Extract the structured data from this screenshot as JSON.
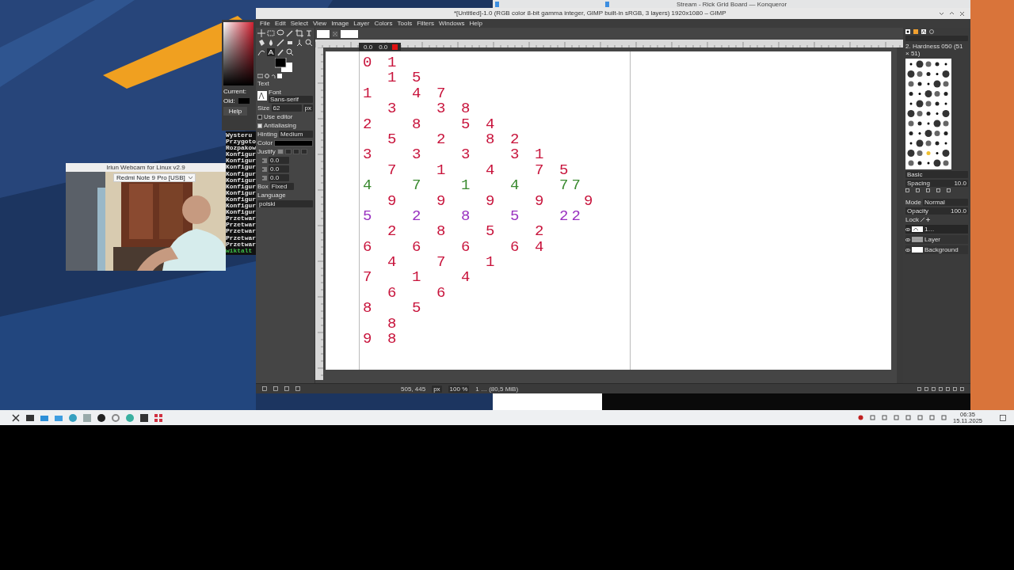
{
  "konqueror_window": {
    "title": "Stream - Rick Grid Board — Konqueror"
  },
  "color_dialog": {
    "current_label": "Current:",
    "old_label": "Old:",
    "help_button": "Help"
  },
  "terminal": {
    "lines": [
      {
        "text": "Wysteru",
        "kind": "output"
      },
      {
        "text": "Przygoto",
        "kind": "output"
      },
      {
        "text": "Rozpakow",
        "kind": "output"
      },
      {
        "text": "Konfigur",
        "kind": "output"
      },
      {
        "text": "Konfigur",
        "kind": "output"
      },
      {
        "text": "Konfigur",
        "kind": "output"
      },
      {
        "text": "Konfigur",
        "kind": "output"
      },
      {
        "text": "Konfigur",
        "kind": "output"
      },
      {
        "text": "Konfigur",
        "kind": "output"
      },
      {
        "text": "Konfigur",
        "kind": "output"
      },
      {
        "text": "Konfigur",
        "kind": "output"
      },
      {
        "text": "Konfigur",
        "kind": "output"
      },
      {
        "text": "Konfigur",
        "kind": "output"
      },
      {
        "text": "Przetwar",
        "kind": "output"
      },
      {
        "text": "Przetwar",
        "kind": "output"
      },
      {
        "text": "Przetwar",
        "kind": "output"
      },
      {
        "text": "Przetwar",
        "kind": "output"
      },
      {
        "text": "Przetwar",
        "kind": "output"
      },
      {
        "text": "wiktalt",
        "kind": "prompt"
      }
    ]
  },
  "webcam_window": {
    "title": "Iriun Webcam for Linux v2.9",
    "device": "Redmi Note 9 Pro [USB]"
  },
  "gimp": {
    "title": "*[Untitled]-1.0 (RGB color 8-bit gamma integer, GIMP built-in sRGB, 3 layers) 1920x1080 – GIMP",
    "menu": [
      "File",
      "Edit",
      "Select",
      "View",
      "Image",
      "Layer",
      "Colors",
      "Tools",
      "Filters",
      "Windows",
      "Help"
    ],
    "tool_options": {
      "title": "Text",
      "font_label": "Font",
      "font": "Sans-serif",
      "size_label": "Size",
      "size": "62",
      "unit": "px",
      "checkboxes": [
        {
          "label": "Use editor",
          "checked": false
        },
        {
          "label": "Antialiasing",
          "checked": true
        }
      ],
      "hinting_label": "Hinting",
      "hinting": "Medium",
      "color_label": "Color",
      "justify_label": "Justify",
      "justify": [
        {
          "selected": true
        },
        {
          "selected": false
        },
        {
          "selected": false
        },
        {
          "selected": false
        }
      ],
      "indents": [
        "0.0",
        "0.0",
        "0.0"
      ],
      "box_label": "Box",
      "box": "Fixed",
      "language_label": "Language",
      "language": "polski"
    },
    "text_toolbar": {
      "baseline": "0.0",
      "kerning": "0.0"
    },
    "canvas_rows": [
      {
        "text": "0 1",
        "color": "#c8143c"
      },
      {
        "text": "  1 5",
        "color": "#c8143c"
      },
      {
        "text": "1   4 7",
        "color": "#c8143c"
      },
      {
        "text": "  3   3 8",
        "color": "#c8143c"
      },
      {
        "text": "2   8   5 4",
        "color": "#c8143c"
      },
      {
        "text": "  5   2   8 2",
        "color": "#c8143c"
      },
      {
        "text": "3   3   3   3 1",
        "color": "#c8143c"
      },
      {
        "text": "  7   1   4   7 5",
        "color": "#c8143c"
      },
      {
        "text": "4   7   1   4   77",
        "color": "#3a8a30"
      },
      {
        "text": "  9   9   9   9   9",
        "color": "#c8143c"
      },
      {
        "text": "5   2   8   5   22",
        "color": "#9a32c0"
      },
      {
        "text": "  2   8   5   2",
        "color": "#c8143c"
      },
      {
        "text": "6   6   6   6 4",
        "color": "#c8143c"
      },
      {
        "text": "  4   7   1",
        "color": "#c8143c"
      },
      {
        "text": "7   1   4",
        "color": "#c8143c"
      },
      {
        "text": "  6   6",
        "color": "#c8143c"
      },
      {
        "text": "8   5",
        "color": "#c8143c"
      },
      {
        "text": "  8",
        "color": "#c8143c"
      },
      {
        "text": "9 8",
        "color": "#c8143c"
      }
    ],
    "dock": {
      "brush_title": "2. Hardness 050 (51 × 51)",
      "preset": "Basic",
      "spacing_label": "Spacing",
      "spacing": "10.0",
      "mode_label": "Mode",
      "mode": "Normal",
      "opacity_label": "Opacity",
      "opacity": "100.0",
      "lock_label": "Lock",
      "layers": [
        {
          "name": "1…",
          "visible": true,
          "selected": true,
          "kind": "text"
        },
        {
          "name": "Layer",
          "visible": true,
          "selected": false,
          "kind": "pattern"
        },
        {
          "name": "Background",
          "visible": true,
          "selected": false,
          "kind": "white"
        }
      ]
    },
    "status_bar": {
      "coordinates": "505, 445",
      "unit": "px",
      "zoom": "100 %",
      "info": "1 … (80,5 MiB)"
    }
  },
  "taskbar": {
    "clock": "06:35",
    "date": "15.11.2025"
  }
}
